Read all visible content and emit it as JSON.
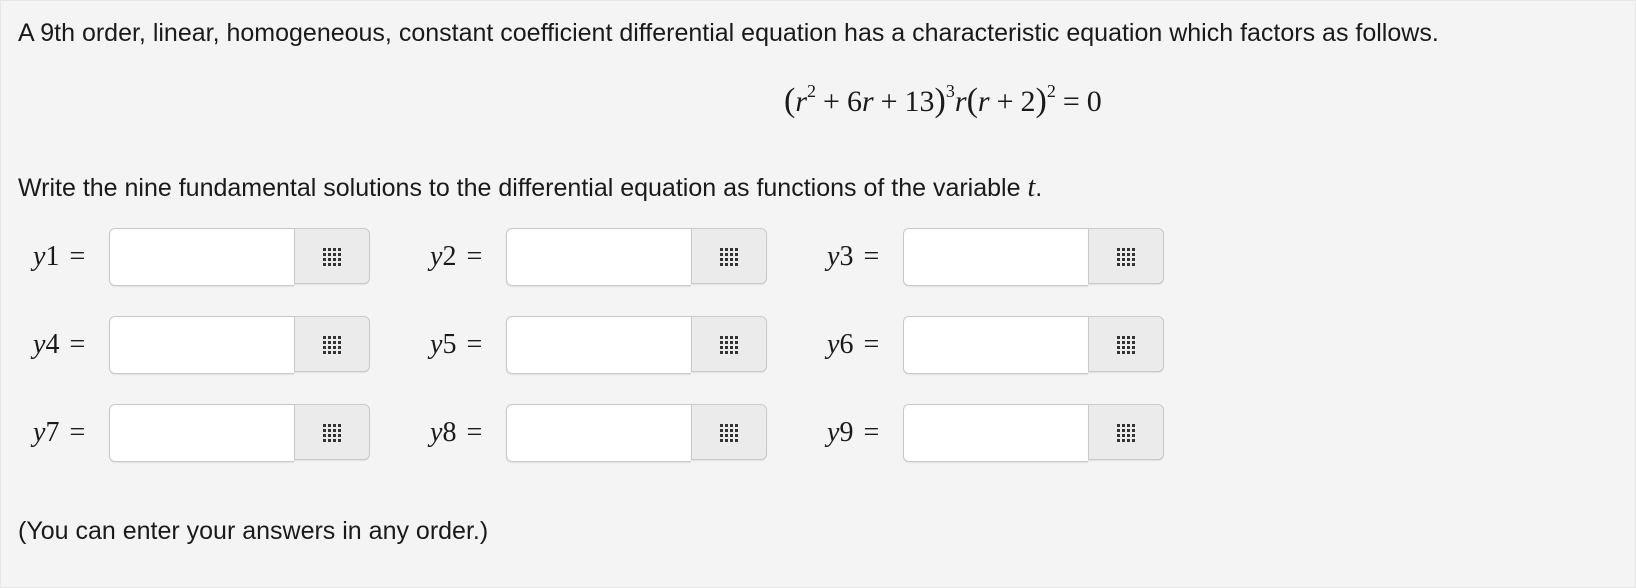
{
  "problem": {
    "intro": "A 9th order, linear, homogeneous, constant coefficient differential equation has a characteristic equation which factors as follows.",
    "equation": {
      "open_paren": "(",
      "var_r": "r",
      "exp_2": "2",
      "plus": "+",
      "coef_6r": "6",
      "const_13": "13",
      "close_paren": ")",
      "exp_3": "3",
      "const_2": "2",
      "equals": "=",
      "rhs": "0"
    },
    "instruction_prefix": "Write the nine fundamental solutions to the differential equation as functions of the variable ",
    "instruction_var": "t",
    "instruction_suffix": ".",
    "footer": "(You can enter your answers in any order.)"
  },
  "answers": [
    {
      "label": "y",
      "sub": "1",
      "eq": "=",
      "value": ""
    },
    {
      "label": "y",
      "sub": "2",
      "eq": "=",
      "value": ""
    },
    {
      "label": "y",
      "sub": "3",
      "eq": "=",
      "value": ""
    },
    {
      "label": "y",
      "sub": "4",
      "eq": "=",
      "value": ""
    },
    {
      "label": "y",
      "sub": "5",
      "eq": "=",
      "value": ""
    },
    {
      "label": "y",
      "sub": "6",
      "eq": "=",
      "value": ""
    },
    {
      "label": "y",
      "sub": "7",
      "eq": "=",
      "value": ""
    },
    {
      "label": "y",
      "sub": "8",
      "eq": "=",
      "value": ""
    },
    {
      "label": "y",
      "sub": "9",
      "eq": "=",
      "value": ""
    }
  ],
  "icons": {
    "entry_tool": "math-palette-grid-icon"
  }
}
